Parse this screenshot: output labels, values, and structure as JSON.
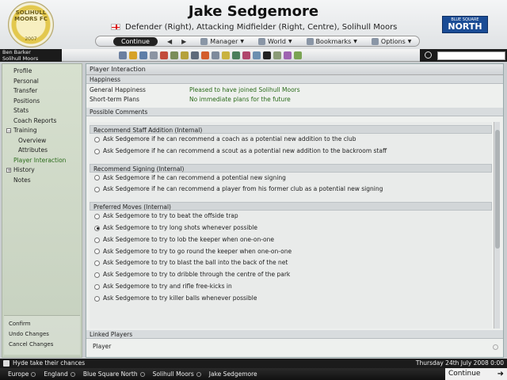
{
  "header": {
    "player_name": "Jake Sedgemore",
    "player_subtitle": "Defender (Right), Attacking Midfielder (Right, Centre), Solihull Moors",
    "club_badge_text": "SOLIHULL MOORS FC",
    "club_badge_year": "2007",
    "league_badge_top": "BLUE SQUARE",
    "league_badge_main": "NORTH"
  },
  "nav": {
    "continue_label": "Continue",
    "manager_label": "Manager",
    "world_label": "World",
    "bookmarks_label": "Bookmarks",
    "options_label": "Options"
  },
  "user": {
    "name": "Ben Barker",
    "club": "Solihull Moors"
  },
  "toolbar": {
    "icon_colors": [
      "#6b7fa0",
      "#d7a227",
      "#5e7ea8",
      "#8b94a3",
      "#c24a3b",
      "#7a8d59",
      "#b5a13a",
      "#5e6a7a",
      "#d35d2b",
      "#7d8a9c",
      "#c9b23f",
      "#4a7e5b",
      "#b0456c",
      "#6b8fb0",
      "#222222",
      "#8a9b77",
      "#9e63b1",
      "#7aa353"
    ]
  },
  "sidebar": {
    "items": [
      {
        "label": "Profile"
      },
      {
        "label": "Personal"
      },
      {
        "label": "Transfer"
      },
      {
        "label": "Positions"
      },
      {
        "label": "Stats"
      },
      {
        "label": "Coach Reports"
      },
      {
        "label": "Training"
      },
      {
        "label": "Overview"
      },
      {
        "label": "Attributes"
      },
      {
        "label": "Player Interaction"
      },
      {
        "label": "History"
      },
      {
        "label": "Notes"
      }
    ],
    "actions": [
      "Confirm",
      "Undo Changes",
      "Cancel Changes"
    ]
  },
  "main": {
    "title": "Player Interaction",
    "happiness": {
      "header": "Happiness",
      "rows": [
        {
          "label": "General Happiness",
          "value": "Pleased to have joined Solihull Moors"
        },
        {
          "label": "Short-term Plans",
          "value": "No immediate plans for the future"
        }
      ]
    },
    "possible_comments_header": "Possible Comments",
    "groups": [
      {
        "header": "Recommend Staff Addition (Internal)",
        "options": [
          "Ask Sedgemore if he can recommend a coach as a potential new addition to the club",
          "Ask Sedgemore if he can recommend a scout as a potential new addition to the backroom staff"
        ]
      },
      {
        "header": "Recommend Signing (Internal)",
        "options": [
          "Ask Sedgemore if he can recommend a potential new signing",
          "Ask Sedgemore if he can recommend a player from his former club as a potential new signing"
        ]
      },
      {
        "header": "Preferred Moves (Internal)",
        "options": [
          "Ask Sedgemore to try to beat the offside trap",
          "Ask Sedgemore to try long shots whenever possible",
          "Ask Sedgemore to try to lob the keeper when one-on-one",
          "Ask Sedgemore to try to go round the keeper when one-on-one",
          "Ask Sedgemore to try to blast the ball into the back of the net",
          "Ask Sedgemore to try to dribble through the centre of the park",
          "Ask Sedgemore to try and rifle free-kicks in",
          "Ask Sedgemore to try killer balls whenever possible"
        ],
        "selected_index": 1
      }
    ],
    "linked_players_header": "Linked Players",
    "linked_players_row": "Player"
  },
  "footer": {
    "news": "Hyde take their chances",
    "date": "Thursday 24th July 2008 0:00",
    "breadcrumbs": [
      "Europe",
      "England",
      "Blue Square North",
      "Solihull Moors",
      "Jake Sedgemore"
    ],
    "continue_label": "Continue"
  }
}
